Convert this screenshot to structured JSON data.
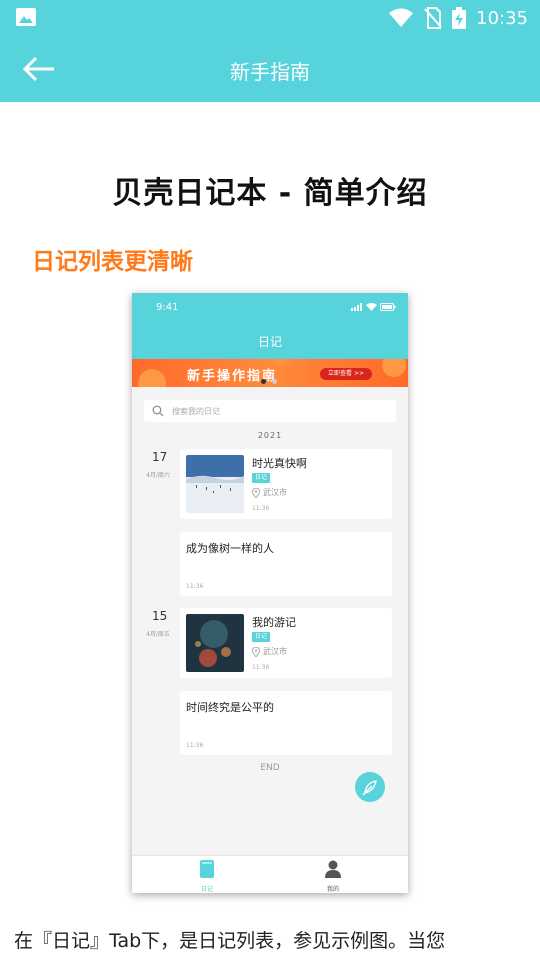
{
  "status_bar": {
    "time": "10:35"
  },
  "toolbar": {
    "title": "新手指南"
  },
  "article": {
    "title": "贝壳日记本 - 简单介绍",
    "section_heading": "日记列表更清晰",
    "paragraph": "在『日记』Tab下，是日记列表，参见示例图。当您"
  },
  "example": {
    "status_time": "9:41",
    "title": "日记",
    "banner": {
      "text": "新手操作指南",
      "button": "立即查看 >>"
    },
    "search_placeholder": "搜索我的日记",
    "year": "2021",
    "groups": [
      {
        "day": "17",
        "sub": "4月/周六"
      },
      {
        "day": "15",
        "sub": "4月/周五"
      }
    ],
    "entries": [
      {
        "title": "时光真快啊",
        "tag": "日记",
        "location": "武汉市",
        "time": "11:36"
      },
      {
        "title": "成为像树一样的人",
        "time": "11:36"
      },
      {
        "title": "我的游记",
        "tag": "日记",
        "location": "武汉市",
        "time": "11:36"
      },
      {
        "title": "时间终究是公平的",
        "time": "11:36"
      }
    ],
    "end_text": "END",
    "tabs": [
      {
        "label": "日记"
      },
      {
        "label": "我的"
      }
    ]
  },
  "colors": {
    "accent": "#57d3dc",
    "heading_orange": "#ff7a1a",
    "banner": "#ff7a2a"
  }
}
